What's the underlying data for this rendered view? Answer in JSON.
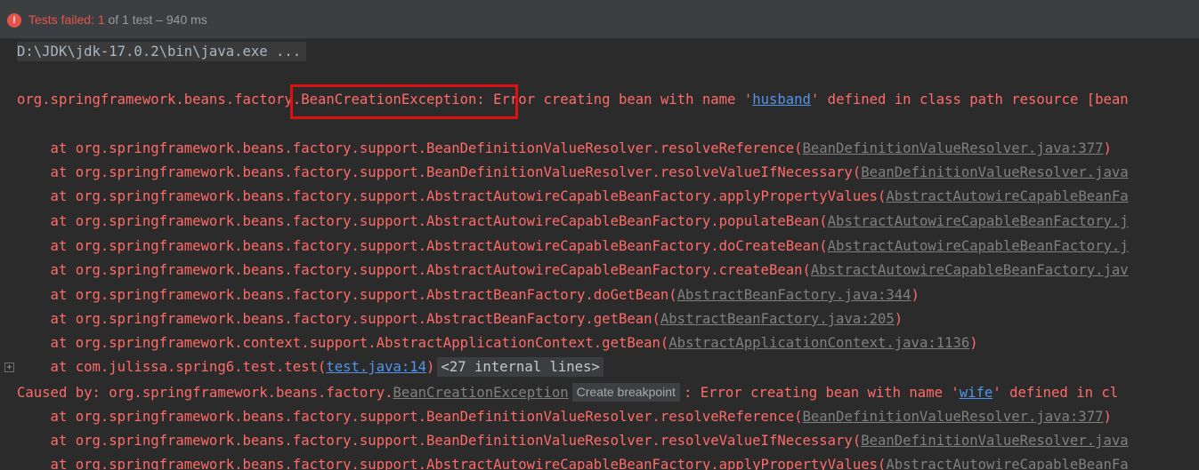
{
  "header": {
    "failed_label": "Tests failed:",
    "failed_count": "1",
    "total": "of 1 test – 940 ms",
    "status_icon": "!"
  },
  "console": {
    "command": "D:\\JDK\\jdk-17.0.2\\bin\\java.exe ...",
    "exception_prefix": "org.springframework.beans.factory",
    "exception_class": ".BeanCreationException:",
    "exception_msg_pre": " Error creating bean with name '",
    "exception_bean": "husband",
    "exception_msg_post": "' defined in class path resource [bean",
    "stack": [
      {
        "text": "    at org.springframework.beans.factory.support.BeanDefinitionValueResolver.resolveReference(",
        "link": "BeanDefinitionValueResolver.java:377",
        "tail": ")"
      },
      {
        "text": "    at org.springframework.beans.factory.support.BeanDefinitionValueResolver.resolveValueIfNecessary(",
        "link": "BeanDefinitionValueResolver.java",
        "tail": ""
      },
      {
        "text": "    at org.springframework.beans.factory.support.AbstractAutowireCapableBeanFactory.applyPropertyValues(",
        "link": "AbstractAutowireCapableBeanFa",
        "tail": ""
      },
      {
        "text": "    at org.springframework.beans.factory.support.AbstractAutowireCapableBeanFactory.populateBean(",
        "link": "AbstractAutowireCapableBeanFactory.j",
        "tail": ""
      },
      {
        "text": "    at org.springframework.beans.factory.support.AbstractAutowireCapableBeanFactory.doCreateBean(",
        "link": "AbstractAutowireCapableBeanFactory.j",
        "tail": ""
      },
      {
        "text": "    at org.springframework.beans.factory.support.AbstractAutowireCapableBeanFactory.createBean(",
        "link": "AbstractAutowireCapableBeanFactory.jav",
        "tail": ""
      },
      {
        "text": "    at org.springframework.beans.factory.support.AbstractBeanFactory.doGetBean(",
        "link": "AbstractBeanFactory.java:344",
        "tail": ")"
      },
      {
        "text": "    at org.springframework.beans.factory.support.AbstractBeanFactory.getBean(",
        "link": "AbstractBeanFactory.java:205",
        "tail": ")"
      },
      {
        "text": "    at org.springframework.context.support.AbstractApplicationContext.getBean(",
        "link": "AbstractApplicationContext.java:1136",
        "tail": ")"
      }
    ],
    "test_frame": {
      "text": "    at com.julissa.spring6.test.test(",
      "link": "test.java:14",
      "tail": ")",
      "internal_lines": "<27 internal lines>"
    },
    "fold_icon": "+",
    "caused_by": {
      "prefix": "Caused by: org.springframework.beans.factory.",
      "class_link": "BeanCreationException",
      "tooltip": "Create breakpoint",
      "msg_pre": ": Error creating bean with name '",
      "bean": "wife",
      "msg_post": "' defined in cl"
    },
    "stack2": [
      {
        "text": "    at org.springframework.beans.factory.support.BeanDefinitionValueResolver.resolveReference(",
        "link": "BeanDefinitionValueResolver.java:377",
        "tail": ")"
      },
      {
        "text": "    at org.springframework.beans.factory.support.BeanDefinitionValueResolver.resolveValueIfNecessary(",
        "link": "BeanDefinitionValueResolver.java",
        "tail": ""
      },
      {
        "text": "    at org.springframework.beans.factory.support.AbstractAutowireCapableBeanFactory.applyPropertyValues(",
        "link": "AbstractAutowireCapableBeanFa",
        "tail": ""
      }
    ]
  },
  "colors": {
    "error_red": "#ff6b68",
    "link_blue": "#5394ec",
    "highlight_box": "#e01010",
    "background": "#2b2b2b"
  }
}
